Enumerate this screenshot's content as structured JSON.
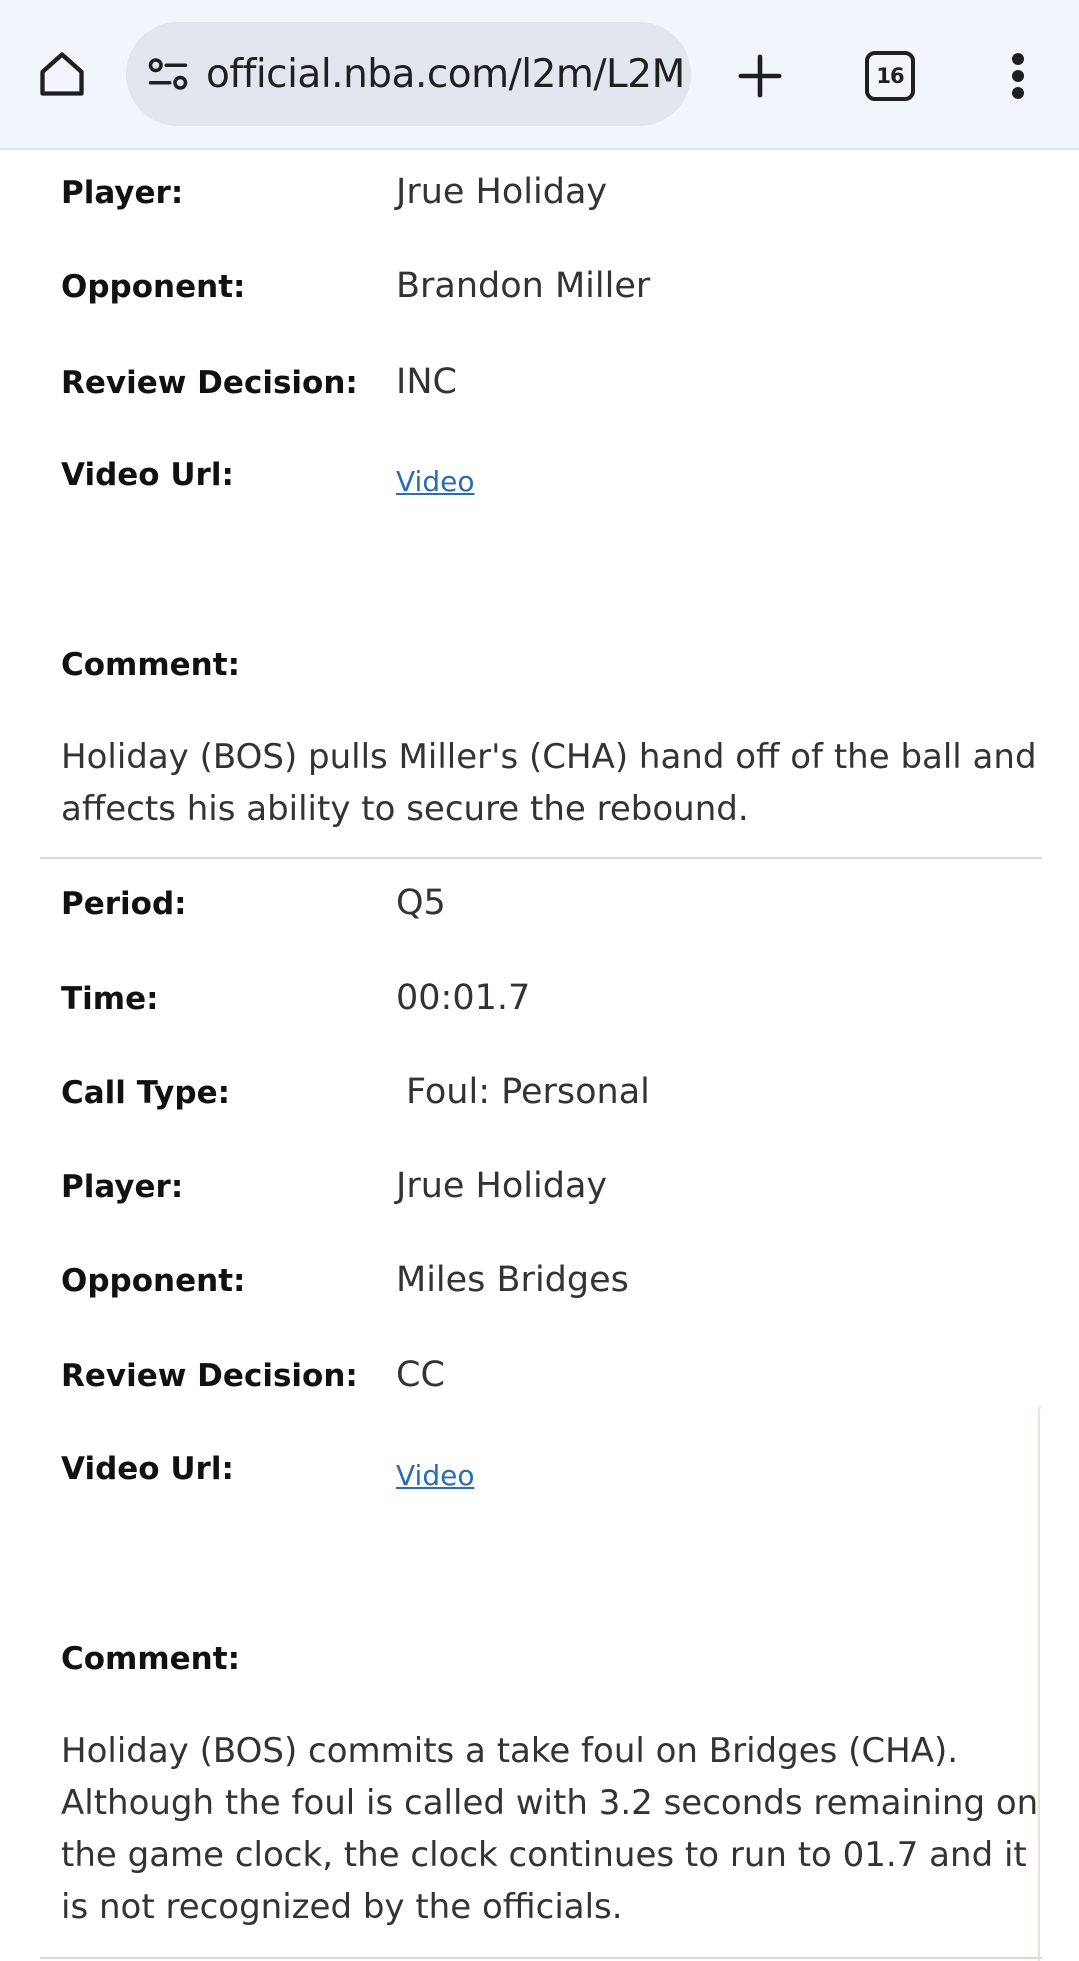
{
  "browser": {
    "url": "official.nba.com/l2m/L2M",
    "tab_count": "16",
    "icons": {
      "home": "home-icon",
      "site_info": "site-settings-icon",
      "new_tab": "plus-icon",
      "tabs": "tab-switcher-icon",
      "menu": "more-vert-icon"
    }
  },
  "labels": {
    "period": "Period:",
    "time": "Time:",
    "call_type": "Call Type:",
    "player": "Player:",
    "opponent": "Opponent:",
    "review_decision": "Review Decision:",
    "video_url": "Video Url:",
    "comment": "Comment:"
  },
  "entries": [
    {
      "player": "Jrue Holiday",
      "opponent": "Brandon Miller",
      "review_decision": "INC",
      "video_link": "Video",
      "comment": "Holiday (BOS) pulls Miller's (CHA) hand off of the ball and affects his ability to secure the rebound."
    },
    {
      "period": "Q5",
      "time": "00:01.7",
      "call_type": "Foul: Personal",
      "player": "Jrue Holiday",
      "opponent": "Miles Bridges",
      "review_decision": "CC",
      "video_link": "Video",
      "comment": "Holiday (BOS) commits a take foul on Bridges (CHA). Although the foul is called with 3.2 seconds remaining on the game clock, the clock continues to run to 01.7 and it is not recognized by the officials."
    }
  ],
  "colors": {
    "link": "#2a6db5",
    "toolbar_bg": "#f2f5fb",
    "omnibox_bg": "#e1e6ef"
  }
}
